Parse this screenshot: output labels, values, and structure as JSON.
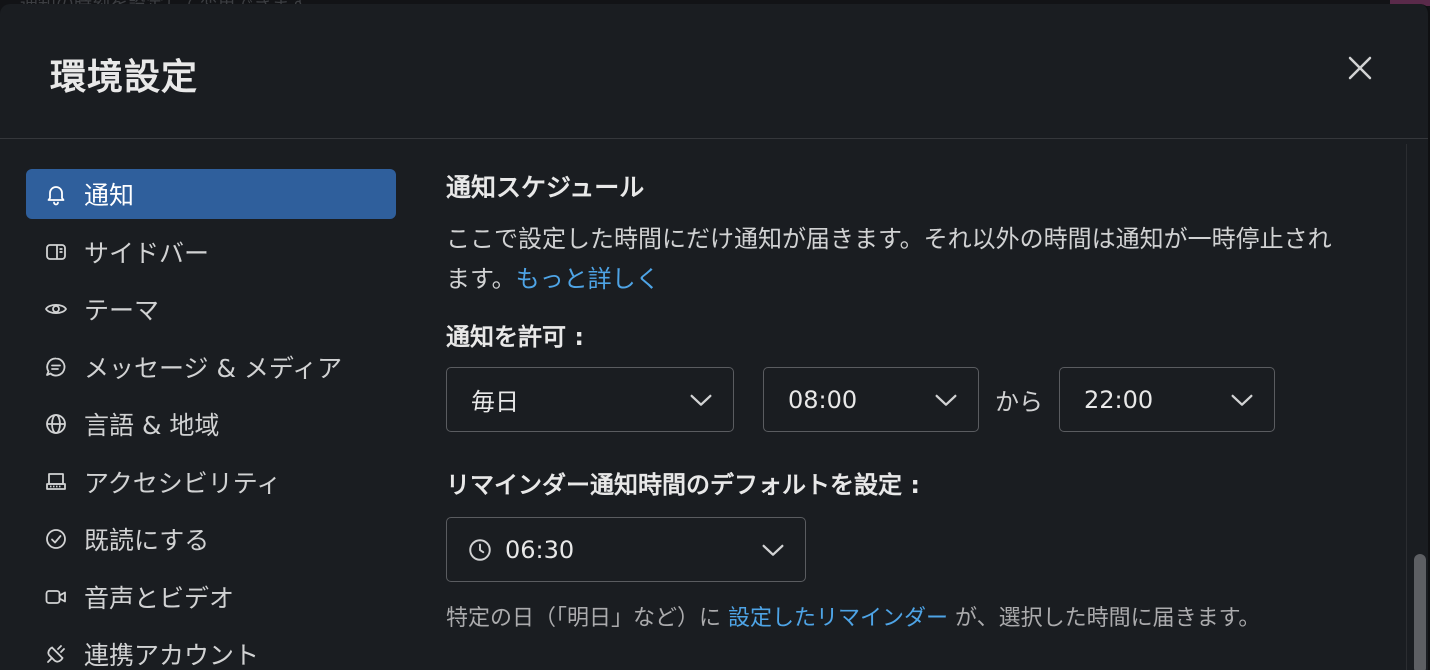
{
  "backdrop": {
    "text": "通知の時刻を設定して変更できます",
    "accent_color": "#5a2a4a"
  },
  "modal": {
    "title": "環境設定",
    "close_icon": "close-icon"
  },
  "sidebar": {
    "items": [
      {
        "label": "通知",
        "icon": "bell-icon",
        "active": true
      },
      {
        "label": "サイドバー",
        "icon": "sidebar-icon",
        "active": false
      },
      {
        "label": "テーマ",
        "icon": "eye-icon",
        "active": false
      },
      {
        "label": "メッセージ & メディア",
        "icon": "message-icon",
        "active": false
      },
      {
        "label": "言語 & 地域",
        "icon": "globe-icon",
        "active": false
      },
      {
        "label": "アクセシビリティ",
        "icon": "keyboard-icon",
        "active": false
      },
      {
        "label": "既読にする",
        "icon": "check-circle-icon",
        "active": false
      },
      {
        "label": "音声とビデオ",
        "icon": "video-icon",
        "active": false
      },
      {
        "label": "連携アカウント",
        "icon": "plug-icon",
        "active": false
      }
    ]
  },
  "schedule": {
    "title": "通知スケジュール",
    "description": "ここで設定した時間にだけ通知が届きます。それ以外の時間は通知が一時停止されます。",
    "learn_more": "もっと詳しく",
    "allow_label": "通知を許可 :",
    "day_value": "毎日",
    "from_value": "08:00",
    "kara": "から",
    "to_value": "22:00"
  },
  "reminder": {
    "label": "リマインダー通知時間のデフォルトを設定 :",
    "time_value": "06:30",
    "note_prefix": "特定の日（「明日」など）に ",
    "note_link": "設定したリマインダー",
    "note_suffix": " が、選択した時間に届きます。"
  },
  "colors": {
    "accent": "#2f5f9c",
    "link": "#4ea4e6",
    "background": "#1a1d21"
  }
}
